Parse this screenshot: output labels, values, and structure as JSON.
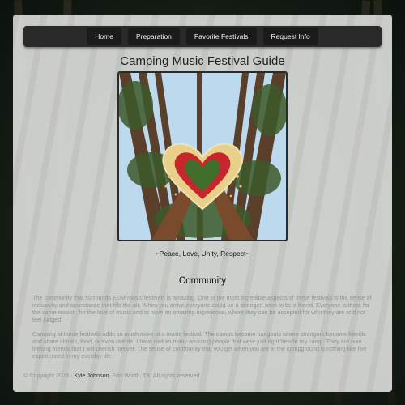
{
  "nav": {
    "items": [
      {
        "label": "Home"
      },
      {
        "label": "Preparation"
      },
      {
        "label": "Favorite Festivals"
      },
      {
        "label": "Request Info"
      }
    ]
  },
  "page": {
    "title": "Camping Music Festival Guide",
    "caption": "~Peace, Love, Unity, Respect~"
  },
  "community": {
    "heading": "Community",
    "paragraphs": [
      "The community that surrounds EDM music festivals is amazing. One of the most incredible aspects of these festivals is the sense of inclusivity and acceptance that fills the air. When you arrive everyone could be a stranger, soon to be a friend. Everyone is there for the same reason, for the love of music and to have an amazing experience, where they can be accepted for who they are and not feel judged.",
      "Camping at these festivals adds so much more to a music festival. The camps become hangouts where strangers become friends and share stories, food, or even talents. I have met so many amazing people that were just right beside my camp. They are now lifelong friends that I will cherish forever. The sense of community that you get when you are in the campground is nothing like I've experienced in my everday life."
    ]
  },
  "footer": {
    "copyright": "© Copyright 2023 ·",
    "author": "Kyle Johnson",
    "rest": ", Fort Worth, TX. All rights reserved."
  },
  "colors": {
    "nav_bg": "#2a2a2a",
    "nav_button_bg": "#1b1b1b",
    "heart_red": "#c8262d",
    "heart_flowers": "#e8d08a"
  },
  "icons": {
    "photo": "heart-hands-forest-photo"
  }
}
